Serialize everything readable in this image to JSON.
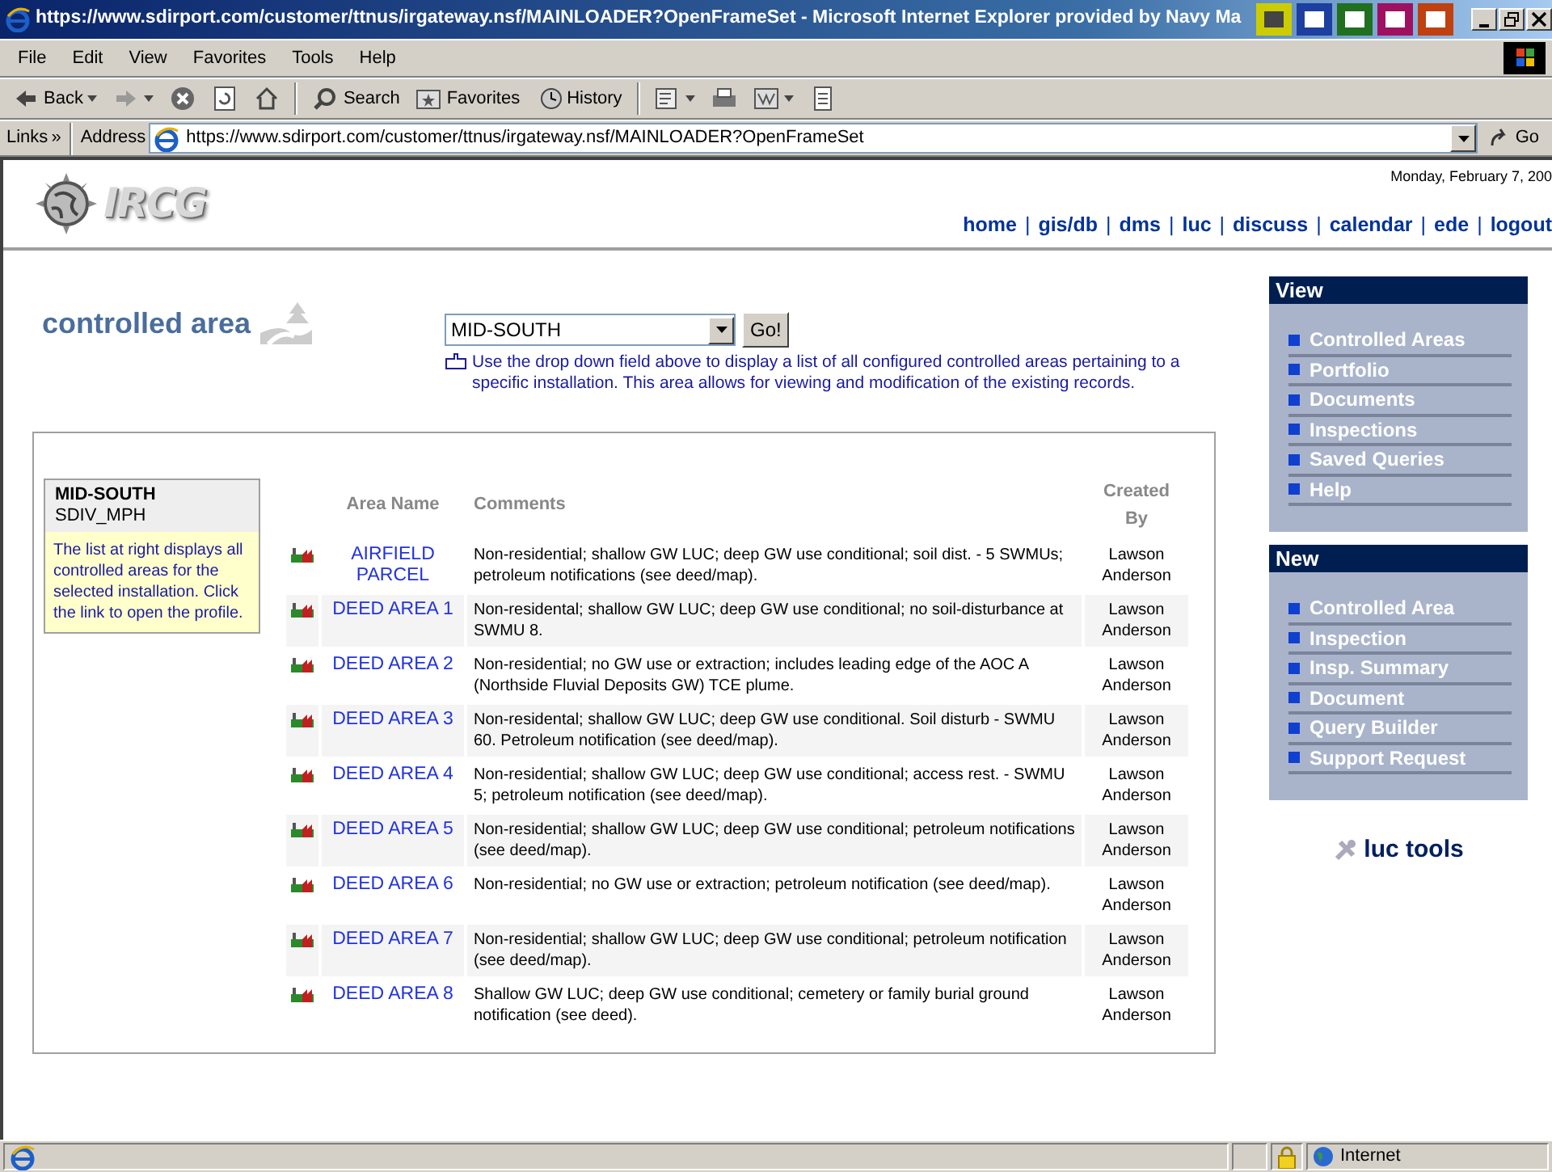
{
  "window": {
    "title": "https://www.sdirport.com/customer/ttnus/irgateway.nsf/MAINLOADER?OpenFrameSet - Microsoft Internet Explorer provided by Navy Ma"
  },
  "menu": [
    "File",
    "Edit",
    "View",
    "Favorites",
    "Tools",
    "Help"
  ],
  "toolbar": [
    {
      "kind": "back",
      "label": "Back"
    },
    {
      "kind": "forward"
    },
    {
      "kind": "stop"
    },
    {
      "kind": "refresh"
    },
    {
      "kind": "home"
    },
    {
      "kind": "sep"
    },
    {
      "kind": "search",
      "label": "Search"
    },
    {
      "kind": "favorites",
      "label": "Favorites"
    },
    {
      "kind": "history",
      "label": "History"
    },
    {
      "kind": "sep"
    },
    {
      "kind": "mail"
    },
    {
      "kind": "print"
    },
    {
      "kind": "edit"
    },
    {
      "kind": "discuss"
    }
  ],
  "address_bar": {
    "links": "Links",
    "chevron": "»",
    "label": "Address",
    "url": "https://www.sdirport.com/customer/ttnus/irgateway.nsf/MAINLOADER?OpenFrameSet",
    "go": "Go"
  },
  "header": {
    "logo": "IRCG",
    "date": "Monday, February 7, 200",
    "nav": {
      "separator": "|",
      "links": [
        "home",
        "gis/db",
        "dms",
        "luc",
        "discuss",
        "calendar",
        "ede",
        "logout"
      ]
    }
  },
  "section_title": "controlled area",
  "selector": {
    "value": "MID-SOUTH",
    "go": "Go!",
    "help": "Use the drop down field above to display a list of all configured controlled areas pertaining to a specific installation. This area allows for viewing and modification of the existing records."
  },
  "installation": {
    "name": "MID-SOUTH",
    "code": "SDIV_MPH",
    "note": "The list at right displays all controlled areas for the selected installation. Click the link to open the profile."
  },
  "table": {
    "columns": [
      "Area Name",
      "Comments",
      "Created By"
    ],
    "rows": [
      {
        "area_name": "AIRFIELD PARCEL",
        "comments": "Non-residential; shallow GW LUC; deep GW use conditional; soil dist. - 5 SWMUs; petroleum notifications (see deed/map).",
        "created_by": "Lawson Anderson"
      },
      {
        "area_name": "DEED AREA 1",
        "comments": "Non-residental; shallow GW LUC; deep GW use conditional; no soil-disturbance at SWMU 8.",
        "created_by": "Lawson Anderson"
      },
      {
        "area_name": "DEED AREA 2",
        "comments": "Non-residential; no GW use or extraction; includes leading edge of the AOC A (Northside Fluvial Deposits GW) TCE plume.",
        "created_by": "Lawson Anderson"
      },
      {
        "area_name": "DEED AREA 3",
        "comments": "Non-residental; shallow GW LUC; deep GW use conditional. Soil disturb - SWMU 60. Petroleum notification (see deed/map).",
        "created_by": "Lawson Anderson"
      },
      {
        "area_name": "DEED AREA 4",
        "comments": "Non-residential; shallow GW LUC; deep GW use conditional; access rest. - SWMU 5; petroleum notification (see deed/map).",
        "created_by": "Lawson Anderson"
      },
      {
        "area_name": "DEED AREA 5",
        "comments": "Non-residential; shallow GW LUC; deep GW use conditional; petroleum notifications (see deed/map).",
        "created_by": "Lawson Anderson"
      },
      {
        "area_name": "DEED AREA 6",
        "comments": "Non-residential; no GW use or extraction; petroleum notification (see deed/map).",
        "created_by": "Lawson Anderson"
      },
      {
        "area_name": "DEED AREA 7",
        "comments": "Non-residential; shallow GW LUC; deep GW use conditional; petroleum notification (see deed/map).",
        "created_by": "Lawson Anderson"
      },
      {
        "area_name": "DEED AREA 8",
        "comments": "Shallow GW LUC; deep GW use conditional; cemetery or family burial ground notification (see deed).",
        "created_by": "Lawson Anderson"
      }
    ]
  },
  "sidebar": {
    "panels": [
      {
        "title": "View",
        "items": [
          "Controlled Areas",
          "Portfolio",
          "Documents",
          "Inspections",
          "Saved Queries",
          "Help"
        ]
      },
      {
        "title": "New",
        "items": [
          "Controlled Area",
          "Inspection",
          "Insp. Summary",
          "Document",
          "Query Builder",
          "Support Request"
        ]
      }
    ],
    "tools_label": "luc tools"
  },
  "status_bar": {
    "zone": "Internet"
  }
}
